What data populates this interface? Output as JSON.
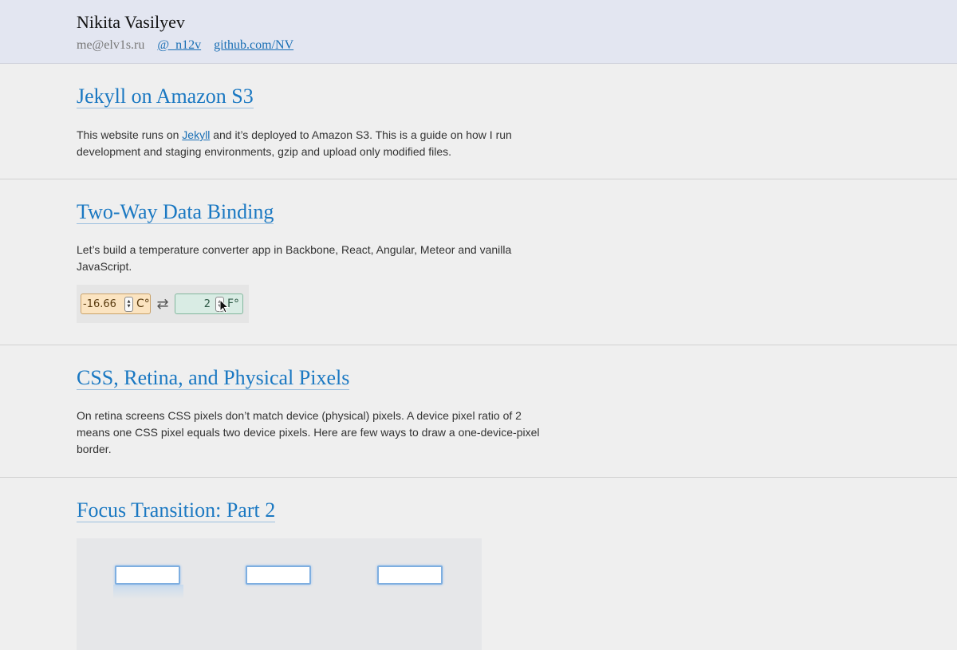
{
  "header": {
    "name": "Nikita Vasilyev",
    "email": "me@elv1s.ru",
    "twitter": "@_n12v",
    "github": "github.com/NV"
  },
  "posts": [
    {
      "title": "Jekyll on Amazon S3",
      "text_before": "This website runs on ",
      "link": "Jekyll",
      "text_after": " and it’s deployed to Amazon S3. This is a guide on how I run development and staging environments, gzip and upload only modified files."
    },
    {
      "title": "Two-Way Data Binding",
      "text": "Let’s build a temperature converter app in Backbone, React, Angular, Meteor and vanilla JavaScript.",
      "converter": {
        "celsius_value": "-16.66",
        "celsius_unit": "C°",
        "swap_symbol": "⇄",
        "fahrenheit_value": "2",
        "fahrenheit_unit": "F°"
      }
    },
    {
      "title": "CSS, Retina, and Physical Pixels",
      "text": "On retina screens CSS pixels don’t match device (physical) pixels. A device pixel ratio of 2 means one CSS pixel equals two device pixels. Here are few ways to draw a one-device-pixel border."
    },
    {
      "title": "Focus Transition: Part 2"
    }
  ],
  "colors": {
    "header_bg": "#e3e6f1",
    "link": "#1a78c2",
    "page_bg": "#efefef"
  }
}
